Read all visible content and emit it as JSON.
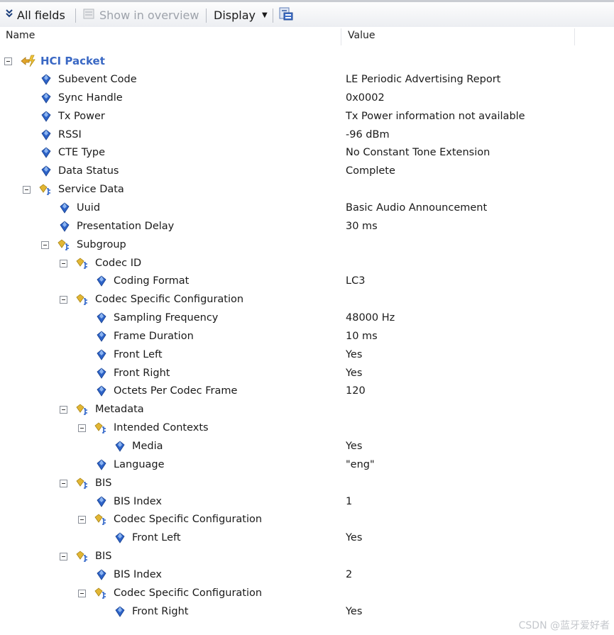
{
  "toolbar": {
    "all_fields": "All fields",
    "show_overview": "Show in overview",
    "display": "Display"
  },
  "columns": {
    "name": "Name",
    "value": "Value"
  },
  "tree": {
    "root": "HCI Packet",
    "rows": [
      {
        "name": "Subevent Code",
        "value": "LE Periodic Advertising Report"
      },
      {
        "name": "Sync Handle",
        "value": "0x0002"
      },
      {
        "name": "Tx Power",
        "value": "Tx Power information not available"
      },
      {
        "name": "RSSI",
        "value": "-96 dBm"
      },
      {
        "name": "CTE Type",
        "value": "No Constant Tone Extension"
      },
      {
        "name": "Data Status",
        "value": "Complete"
      },
      {
        "name": "Service Data",
        "value": ""
      },
      {
        "name": "Uuid",
        "value": "Basic Audio Announcement"
      },
      {
        "name": "Presentation Delay",
        "value": "30 ms"
      },
      {
        "name": "Subgroup",
        "value": ""
      },
      {
        "name": "Codec ID",
        "value": ""
      },
      {
        "name": "Coding Format",
        "value": "LC3"
      },
      {
        "name": "Codec Specific Configuration",
        "value": ""
      },
      {
        "name": "Sampling Frequency",
        "value": "48000 Hz"
      },
      {
        "name": "Frame Duration",
        "value": "10 ms"
      },
      {
        "name": "Front Left",
        "value": "Yes"
      },
      {
        "name": "Front Right",
        "value": "Yes"
      },
      {
        "name": "Octets Per Codec Frame",
        "value": "120"
      },
      {
        "name": "Metadata",
        "value": ""
      },
      {
        "name": "Intended Contexts",
        "value": ""
      },
      {
        "name": "Media",
        "value": "Yes"
      },
      {
        "name": "Language",
        "value": "\"eng\""
      },
      {
        "name": "BIS",
        "value": ""
      },
      {
        "name": "BIS Index",
        "value": "1"
      },
      {
        "name": "Codec Specific Configuration",
        "value": ""
      },
      {
        "name": "Front Left",
        "value": "Yes"
      },
      {
        "name": "BIS",
        "value": ""
      },
      {
        "name": "BIS Index",
        "value": "2"
      },
      {
        "name": "Codec Specific Configuration",
        "value": ""
      },
      {
        "name": "Front Right",
        "value": "Yes"
      }
    ]
  },
  "watermark": "CSDN @蓝牙爱好者",
  "colors": {
    "root_text": "#3a68c4",
    "field_icon": "#2d63c8",
    "group_icon": "#e2b634"
  }
}
